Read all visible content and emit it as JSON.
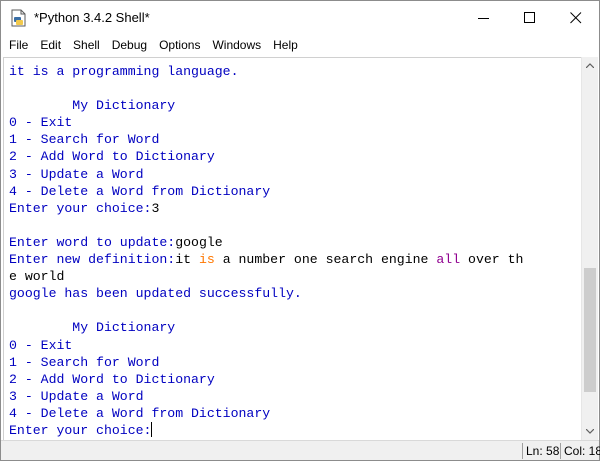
{
  "window": {
    "title": "*Python 3.4.2 Shell*",
    "controls": [
      "minimize",
      "maximize",
      "close"
    ]
  },
  "menu": [
    "File",
    "Edit",
    "Shell",
    "Debug",
    "Options",
    "Windows",
    "Help"
  ],
  "shell": {
    "lines": [
      [
        {
          "text": "it is a programming language.",
          "style": "output"
        }
      ],
      [
        {
          "text": "",
          "style": "output"
        }
      ],
      [
        {
          "text": "        My Dictionary",
          "style": "output"
        }
      ],
      [
        {
          "text": "0 - Exit",
          "style": "output"
        }
      ],
      [
        {
          "text": "1 - Search for Word",
          "style": "output"
        }
      ],
      [
        {
          "text": "2 - Add Word to Dictionary",
          "style": "output"
        }
      ],
      [
        {
          "text": "3 - Update a Word",
          "style": "output"
        }
      ],
      [
        {
          "text": "4 - Delete a Word from Dictionary",
          "style": "output"
        }
      ],
      [
        {
          "text": "Enter your choice:",
          "style": "output"
        },
        {
          "text": "3",
          "style": "input"
        }
      ],
      [
        {
          "text": "",
          "style": "output"
        }
      ],
      [
        {
          "text": "Enter word to update:",
          "style": "output"
        },
        {
          "text": "google",
          "style": "input"
        }
      ],
      [
        {
          "text": "Enter new definition:",
          "style": "output"
        },
        {
          "text": "it ",
          "style": "input"
        },
        {
          "text": "is",
          "style": "keyword"
        },
        {
          "text": " a number one search engine ",
          "style": "input"
        },
        {
          "text": "all",
          "style": "builtin"
        },
        {
          "text": " over th",
          "style": "input"
        }
      ],
      [
        {
          "text": "e world",
          "style": "input"
        }
      ],
      [
        {
          "text": "google has been updated successfully.",
          "style": "output"
        }
      ],
      [
        {
          "text": "",
          "style": "output"
        }
      ],
      [
        {
          "text": "        My Dictionary",
          "style": "output"
        }
      ],
      [
        {
          "text": "0 - Exit",
          "style": "output"
        }
      ],
      [
        {
          "text": "1 - Search for Word",
          "style": "output"
        }
      ],
      [
        {
          "text": "2 - Add Word to Dictionary",
          "style": "output"
        }
      ],
      [
        {
          "text": "3 - Update a Word",
          "style": "output"
        }
      ],
      [
        {
          "text": "4 - Delete a Word from Dictionary",
          "style": "output"
        }
      ],
      [
        {
          "text": "Enter your choice:",
          "style": "output"
        }
      ]
    ],
    "colors": {
      "output": "#0000c0",
      "input": "#000000",
      "keyword": "#ff7700",
      "builtin": "#900090"
    }
  },
  "scrollbar": {
    "position": 0.86
  },
  "status": {
    "ln": "Ln: 58",
    "col": "Col: 18"
  }
}
